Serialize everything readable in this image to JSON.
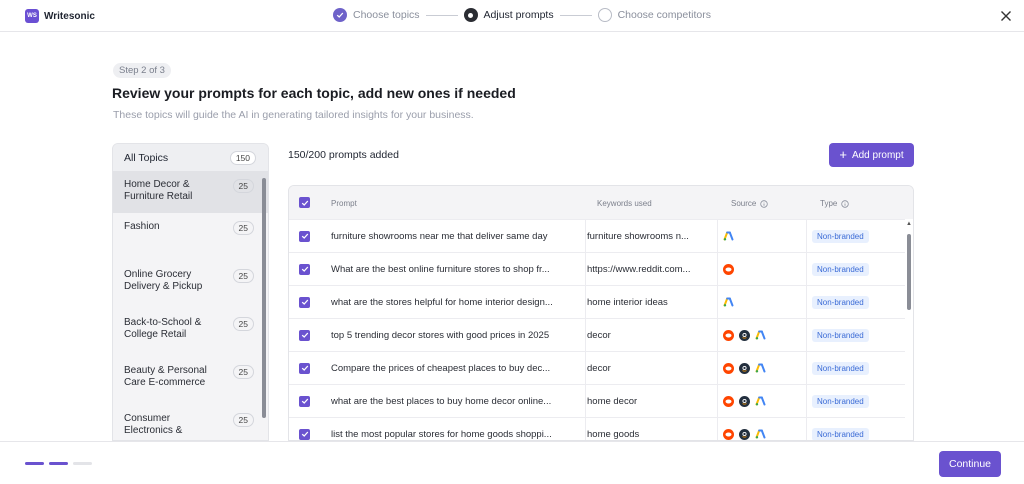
{
  "app": {
    "name": "Writesonic",
    "logo_mark": "WS"
  },
  "stepper": {
    "steps": [
      {
        "label": "Choose topics",
        "state": "done"
      },
      {
        "label": "Adjust prompts",
        "state": "active"
      },
      {
        "label": "Choose competitors",
        "state": "todo"
      }
    ]
  },
  "page": {
    "step_badge": "Step 2 of 3",
    "title": "Review your prompts for each topic, add new ones if needed",
    "subtitle": "These topics will guide the AI in generating tailored insights for your business."
  },
  "topics": {
    "header_label": "All Topics",
    "header_count": "150",
    "items": [
      {
        "name": "Home Decor & Furniture Retail",
        "count": "25",
        "active": true
      },
      {
        "name": "Fashion",
        "count": "25"
      },
      {
        "name": "Online Grocery Delivery & Pickup",
        "count": "25"
      },
      {
        "name": "Back-to-School & College Retail",
        "count": "25"
      },
      {
        "name": "Beauty & Personal Care E-commerce",
        "count": "25"
      },
      {
        "name": "Consumer Electronics &",
        "count": "25"
      }
    ]
  },
  "prompts": {
    "added_text": "150/200 prompts added",
    "add_button": "Add prompt",
    "columns": {
      "prompt": "Prompt",
      "keywords": "Keywords used",
      "source": "Source",
      "type": "Type"
    },
    "rows": [
      {
        "prompt": "furniture showrooms near me that deliver same day",
        "keyword": "furniture showrooms n...",
        "sources": [
          "google-ads"
        ],
        "type": "Non-branded"
      },
      {
        "prompt": "What are the best online furniture stores to shop fr...",
        "keyword": "https://www.reddit.com...",
        "sources": [
          "reddit"
        ],
        "type": "Non-branded"
      },
      {
        "prompt": "what are the stores helpful for home interior design...",
        "keyword": "home interior ideas",
        "sources": [
          "google-ads"
        ],
        "type": "Non-branded"
      },
      {
        "prompt": "top 5 trending decor stores with good prices in 2025",
        "keyword": "decor",
        "sources": [
          "reddit",
          "amazon",
          "google-ads"
        ],
        "type": "Non-branded"
      },
      {
        "prompt": "Compare the prices of cheapest places to buy dec...",
        "keyword": "decor",
        "sources": [
          "reddit",
          "amazon",
          "google-ads"
        ],
        "type": "Non-branded"
      },
      {
        "prompt": "what are the best places to buy home decor online...",
        "keyword": "home decor",
        "sources": [
          "reddit",
          "amazon",
          "google-ads"
        ],
        "type": "Non-branded"
      },
      {
        "prompt": "list the most popular stores for home goods shoppi...",
        "keyword": "home goods",
        "sources": [
          "reddit",
          "amazon",
          "google-ads"
        ],
        "type": "Non-branded"
      }
    ]
  },
  "footer": {
    "continue_label": "Continue",
    "progress_dots": [
      "active",
      "active",
      "inactive"
    ]
  },
  "colors": {
    "accent": "#6a52cf",
    "badge_text": "#3b6bd6",
    "badge_bg": "#e8f0fe"
  }
}
